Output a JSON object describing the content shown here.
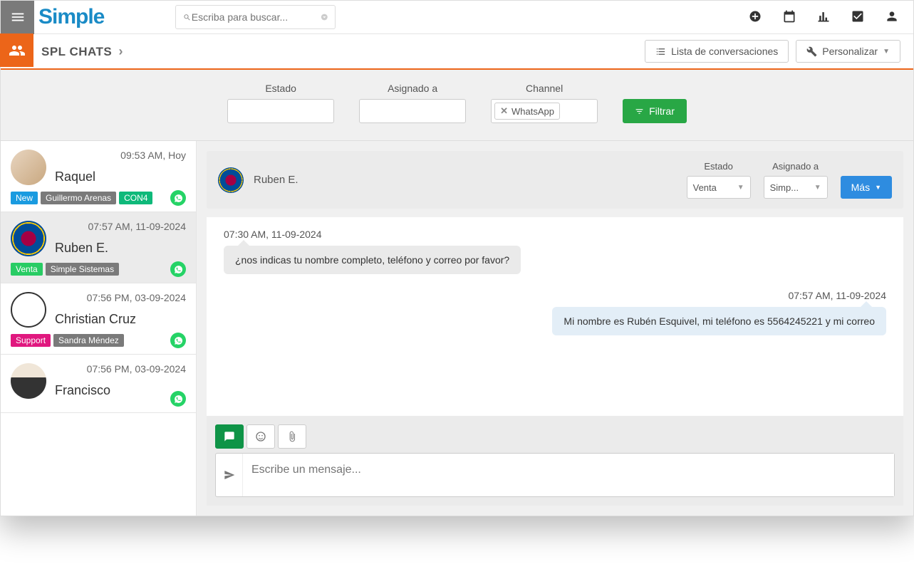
{
  "brand": "Simple",
  "search_placeholder": "Escriba para buscar...",
  "module_title": "SPL CHATS",
  "subheader": {
    "conversations_btn": "Lista de conversaciones",
    "customize_btn": "Personalizar"
  },
  "filters": {
    "estado_label": "Estado",
    "asignado_label": "Asignado a",
    "channel_label": "Channel",
    "channel_value": "WhatsApp",
    "filter_btn": "Filtrar"
  },
  "conversations": [
    {
      "time": "09:53 AM, Hoy",
      "name": "Raquel",
      "badges": [
        {
          "text": "New",
          "cls": "blue"
        },
        {
          "text": "Guillermo Arenas",
          "cls": "gray"
        },
        {
          "text": "CON4",
          "cls": "teal"
        }
      ]
    },
    {
      "time": "07:57 AM, 11-09-2024",
      "name": "Ruben E.",
      "badges": [
        {
          "text": "Venta",
          "cls": "green"
        },
        {
          "text": "Simple Sistemas",
          "cls": "gray"
        }
      ]
    },
    {
      "time": "07:56 PM, 03-09-2024",
      "name": "Christian Cruz",
      "badges": [
        {
          "text": "Support",
          "cls": "pink"
        },
        {
          "text": "Sandra Méndez",
          "cls": "gray"
        }
      ]
    },
    {
      "time": "07:56 PM, 03-09-2024",
      "name": "Francisco",
      "badges": []
    }
  ],
  "chat": {
    "contact_name": "Ruben E.",
    "estado_label": "Estado",
    "estado_value": "Venta",
    "asignado_label": "Asignado a",
    "asignado_value": "Simp...",
    "more_btn": "Más",
    "messages": [
      {
        "time": "07:30 AM, 11-09-2024",
        "text": "¿nos indicas tu nombre completo, teléfono y correo por favor?",
        "side": "left"
      },
      {
        "time": "07:57 AM, 11-09-2024",
        "text": "Mi nombre es Rubén Esquivel, mi teléfono es 5564245221 y mi correo",
        "side": "right"
      }
    ],
    "composer_placeholder": "Escribe un mensaje..."
  }
}
